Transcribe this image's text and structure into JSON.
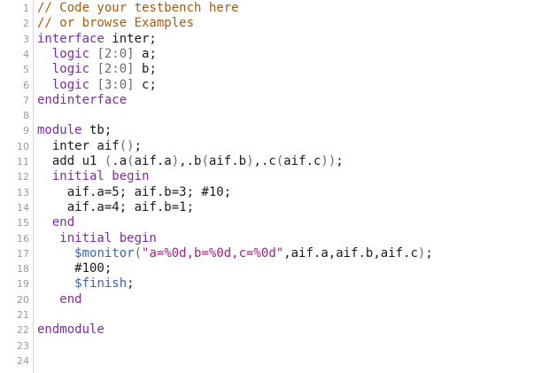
{
  "editor": {
    "line_numbers": [
      "1",
      "2",
      "3",
      "4",
      "5",
      "6",
      "7",
      "8",
      "9",
      "10",
      "11",
      "12",
      "13",
      "14",
      "15",
      "16",
      "17",
      "18",
      "19",
      "20",
      "21",
      "22",
      "23",
      "24"
    ],
    "lines": [
      [
        {
          "t": "// Code your testbench here",
          "c": "comment"
        }
      ],
      [
        {
          "t": "// or browse Examples",
          "c": "comment"
        }
      ],
      [
        {
          "t": "interface",
          "c": "kw"
        },
        {
          "t": " inter;",
          "c": "ident"
        }
      ],
      [
        {
          "t": "  logic",
          "c": "kw"
        },
        {
          "t": " ",
          "c": "ident"
        },
        {
          "t": "[2:0]",
          "c": "bracket"
        },
        {
          "t": " a;",
          "c": "ident"
        }
      ],
      [
        {
          "t": "  logic",
          "c": "kw"
        },
        {
          "t": " ",
          "c": "ident"
        },
        {
          "t": "[2:0]",
          "c": "bracket"
        },
        {
          "t": " b;",
          "c": "ident"
        }
      ],
      [
        {
          "t": "  logic",
          "c": "kw"
        },
        {
          "t": " ",
          "c": "ident"
        },
        {
          "t": "[3:0]",
          "c": "bracket"
        },
        {
          "t": " c;",
          "c": "ident"
        }
      ],
      [
        {
          "t": "endinterface",
          "c": "kw"
        }
      ],
      [],
      [
        {
          "t": "module",
          "c": "kw"
        },
        {
          "t": " tb;",
          "c": "ident"
        }
      ],
      [
        {
          "t": "  inter aif",
          "c": "ident"
        },
        {
          "t": "()",
          "c": "bracket"
        },
        {
          "t": ";",
          "c": "ident"
        }
      ],
      [
        {
          "t": "  add u1 ",
          "c": "ident"
        },
        {
          "t": "(",
          "c": "bracket"
        },
        {
          "t": ".a",
          "c": "ident"
        },
        {
          "t": "(",
          "c": "bracket"
        },
        {
          "t": "aif.a",
          "c": "ident"
        },
        {
          "t": ")",
          "c": "bracket"
        },
        {
          "t": ",.b",
          "c": "ident"
        },
        {
          "t": "(",
          "c": "bracket"
        },
        {
          "t": "aif.b",
          "c": "ident"
        },
        {
          "t": ")",
          "c": "bracket"
        },
        {
          "t": ",.c",
          "c": "ident"
        },
        {
          "t": "(",
          "c": "bracket"
        },
        {
          "t": "aif.c",
          "c": "ident"
        },
        {
          "t": "))",
          "c": "bracket"
        },
        {
          "t": ";",
          "c": "ident"
        }
      ],
      [
        {
          "t": "  initial begin",
          "c": "kw"
        }
      ],
      [
        {
          "t": "    aif.a=5; aif.b=3; #10;",
          "c": "ident"
        }
      ],
      [
        {
          "t": "    aif.a=4; aif.b=1;",
          "c": "ident"
        }
      ],
      [
        {
          "t": "  end",
          "c": "kw"
        }
      ],
      [
        {
          "t": "   initial begin",
          "c": "kw"
        }
      ],
      [
        {
          "t": "     ",
          "c": "ident"
        },
        {
          "t": "$monitor",
          "c": "sys"
        },
        {
          "t": "(",
          "c": "bracket"
        },
        {
          "t": "\"a=%0d,b=%0d,c=%0d\"",
          "c": "str"
        },
        {
          "t": ",aif.a,aif.b,aif.c",
          "c": "ident"
        },
        {
          "t": ")",
          "c": "bracket"
        },
        {
          "t": ";",
          "c": "ident"
        }
      ],
      [
        {
          "t": "     #100;",
          "c": "delay"
        }
      ],
      [
        {
          "t": "     ",
          "c": "ident"
        },
        {
          "t": "$finish",
          "c": "sys"
        },
        {
          "t": ";",
          "c": "ident"
        }
      ],
      [
        {
          "t": "   end",
          "c": "kw"
        }
      ],
      [],
      [
        {
          "t": "endmodule",
          "c": "kw"
        }
      ],
      [],
      []
    ]
  },
  "colors": {
    "comment": "#a65a11",
    "keyword": "#7b2d9c",
    "string": "#a2207f",
    "system_task": "#3d64ad",
    "line_number": "#9a9a9a"
  }
}
